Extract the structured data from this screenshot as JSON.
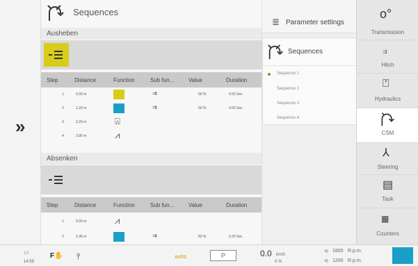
{
  "header": {
    "title": "Sequences"
  },
  "sections": {
    "raise": {
      "label": "Ausheben"
    },
    "lower": {
      "label": "Absenken"
    }
  },
  "table": {
    "columns": [
      "Step",
      "Distance",
      "Function",
      "Sub fun...",
      "Value",
      "Duration"
    ]
  },
  "raise_rows": [
    {
      "step": "1",
      "distance": "0.00 m",
      "value": "59 %",
      "duration": "0.50 Sec"
    },
    {
      "step": "2",
      "distance": "1.20 m",
      "value": "50 %",
      "duration": "0.00 Sec"
    },
    {
      "step": "3",
      "distance": "3.20 m",
      "value": "",
      "duration": ""
    },
    {
      "step": "4",
      "distance": "3.95 m",
      "value": "",
      "duration": ""
    }
  ],
  "lower_rows": [
    {
      "step": "1",
      "distance": "0.00 m",
      "value": "",
      "duration": ""
    },
    {
      "step": "2",
      "distance": "2.35 m",
      "value": "83 %",
      "duration": "0.25 Sec"
    }
  ],
  "parameter_settings": {
    "label": "Parameter settings"
  },
  "popup": {
    "title": "Sequences",
    "items": [
      "Sequence 1",
      "Sequence 2",
      "Sequence 3",
      "Sequence 4"
    ]
  },
  "tabs": [
    "Transmission",
    "Hitch",
    "Hydraulics",
    "CSM",
    "Steering",
    "Task",
    "Counters"
  ],
  "status": {
    "time": "14:59",
    "mode": "AUTO",
    "gear": "P",
    "speed": "0.0",
    "speed_unit": "km/h",
    "slip": "0 %",
    "rpm1": "1800",
    "rpm2": "1200",
    "rpm_unit": "R.p.m."
  },
  "colors": {
    "accent_yellow": "#d8cc1a",
    "accent_cyan": "#1aa0c8",
    "dot_green": "#7a9a1a"
  }
}
